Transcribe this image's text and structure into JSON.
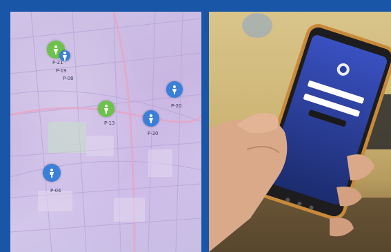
{
  "map": {
    "markers": [
      {
        "id": "P-21",
        "color": "green",
        "icon": "person-icon"
      },
      {
        "id": "P-19",
        "color": "blue",
        "icon": "person-icon"
      },
      {
        "id": "P-08",
        "color": "blue",
        "icon": "person-icon"
      },
      {
        "id": "P-13",
        "color": "green",
        "icon": "person-icon"
      },
      {
        "id": "P-30",
        "color": "blue",
        "icon": "person-icon"
      },
      {
        "id": "P-20",
        "color": "blue",
        "icon": "person-icon"
      },
      {
        "id": "P-04",
        "color": "blue",
        "icon": "person-icon"
      }
    ]
  },
  "phone": {
    "logo_icon": "police-badge-icon"
  },
  "colors": {
    "frame": "#1a56a8",
    "marker_blue": "#3a7fd8",
    "marker_green": "#6cc24a",
    "phone_screen": "#2a3f9e"
  }
}
